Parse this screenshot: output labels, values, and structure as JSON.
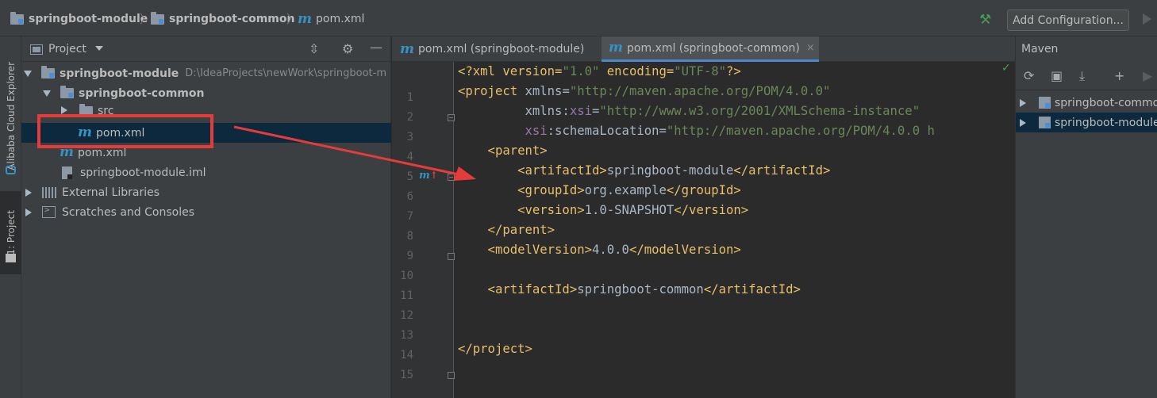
{
  "breadcrumbs": [
    {
      "label": "springboot-module"
    },
    {
      "label": "springboot-common"
    },
    {
      "label": "pom.xml"
    }
  ],
  "toolbar": {
    "add_configuration_label": "Add Configuration..."
  },
  "left_strip": {
    "cloud_explorer_label": "Alibaba Cloud Explorer",
    "project_tab_label": "1: Project"
  },
  "project_panel": {
    "title": "Project",
    "tree": [
      {
        "label": "springboot-module",
        "path": "D:\\IdeaProjects\\newWork\\springboot-m",
        "expanded": true
      },
      {
        "label": "springboot-common",
        "expanded": true
      },
      {
        "label": "src",
        "expanded": false
      },
      {
        "label": "pom.xml",
        "selected": true
      },
      {
        "label": "pom.xml"
      },
      {
        "label": "springboot-module.iml"
      },
      {
        "label": "External Libraries",
        "expanded": false
      },
      {
        "label": "Scratches and Consoles",
        "expanded": false
      }
    ]
  },
  "editor": {
    "tabs": [
      {
        "label": "pom.xml (springboot-module)",
        "active": false
      },
      {
        "label": "pom.xml (springboot-common)",
        "active": true
      }
    ],
    "close_glyph": "×",
    "line_numbers": [
      "1",
      "2",
      "3",
      "4",
      "5",
      "6",
      "7",
      "8",
      "9",
      "10",
      "11",
      "12",
      "13",
      "14",
      "15"
    ],
    "code_lines": [
      [
        {
          "t": "<?xml version=",
          "c": "tag"
        },
        {
          "t": "\"1.0\"",
          "c": "str"
        },
        {
          "t": " encoding=",
          "c": "tag"
        },
        {
          "t": "\"UTF-8\"",
          "c": "str"
        },
        {
          "t": "?>",
          "c": "tag"
        }
      ],
      [
        {
          "t": "<project ",
          "c": "tag"
        },
        {
          "t": "xmlns=",
          "c": "txt"
        },
        {
          "t": "\"http://maven.apache.org/POM/4.0.0\"",
          "c": "str"
        }
      ],
      [
        {
          "t": "         xmlns:",
          "c": "txt"
        },
        {
          "t": "xsi",
          "c": "ns"
        },
        {
          "t": "=",
          "c": "txt"
        },
        {
          "t": "\"http://www.w3.org/2001/XMLSchema-instance\"",
          "c": "str"
        }
      ],
      [
        {
          "t": "         ",
          "c": "txt"
        },
        {
          "t": "xsi",
          "c": "ns"
        },
        {
          "t": ":schemaLocation=",
          "c": "txt"
        },
        {
          "t": "\"http://maven.apache.org/POM/4.0.0 h",
          "c": "str"
        }
      ],
      [
        {
          "t": "    <parent>",
          "c": "tag"
        }
      ],
      [
        {
          "t": "        <artifactId>",
          "c": "tag"
        },
        {
          "t": "springboot-module",
          "c": "txt"
        },
        {
          "t": "</artifactId>",
          "c": "tag"
        }
      ],
      [
        {
          "t": "        <groupId>",
          "c": "tag"
        },
        {
          "t": "org.example",
          "c": "txt"
        },
        {
          "t": "</groupId>",
          "c": "tag"
        }
      ],
      [
        {
          "t": "        <version>",
          "c": "tag"
        },
        {
          "t": "1.0-SNAPSHOT",
          "c": "txt"
        },
        {
          "t": "</version>",
          "c": "tag"
        }
      ],
      [
        {
          "t": "    </parent>",
          "c": "tag"
        }
      ],
      [
        {
          "t": "    <modelVersion>",
          "c": "tag"
        },
        {
          "t": "4.0.0",
          "c": "txt"
        },
        {
          "t": "</modelVersion>",
          "c": "tag"
        }
      ],
      [],
      [
        {
          "t": "    <artifactId>",
          "c": "tag"
        },
        {
          "t": "springboot-common",
          "c": "txt"
        },
        {
          "t": "</artifactId>",
          "c": "tag"
        }
      ],
      [],
      [],
      [
        {
          "t": "</project>",
          "c": "tag"
        }
      ]
    ]
  },
  "maven_panel": {
    "title": "Maven",
    "projects": [
      {
        "label": "springboot-common",
        "selected": false
      },
      {
        "label": "springboot-module",
        "selected": true
      }
    ]
  },
  "colors": {
    "annotation_red": "#e53b3b",
    "selection_blue": "#0d293e",
    "xml_tag": "#e8bf6a",
    "xml_string": "#6a8759"
  }
}
